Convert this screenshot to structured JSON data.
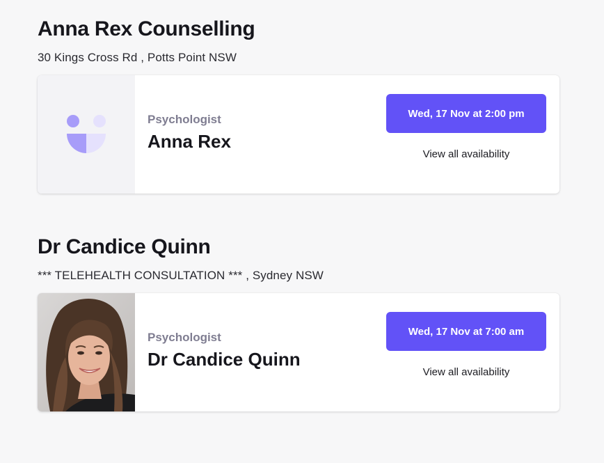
{
  "practices": [
    {
      "title": "Anna Rex Counselling",
      "address": "30 Kings Cross Rd , Potts Point NSW",
      "practitioner": {
        "role": "Psychologist",
        "name": "Anna Rex",
        "avatar": "placeholder-logo-icon"
      },
      "next_slot": "Wed, 17 Nov at 2:00 pm",
      "availability_link": "View all availability"
    },
    {
      "title": "Dr Candice Quinn",
      "address": "*** TELEHEALTH CONSULTATION *** , Sydney NSW",
      "practitioner": {
        "role": "Psychologist",
        "name": "Dr Candice Quinn",
        "avatar": "profile-photo"
      },
      "next_slot": "Wed, 17 Nov at 7:00 am",
      "availability_link": "View all availability"
    }
  ],
  "colors": {
    "accent": "#6252f7",
    "logo_light": "#a79cf9",
    "logo_pale": "#e5e1fd",
    "role_text": "#7f7d91"
  }
}
